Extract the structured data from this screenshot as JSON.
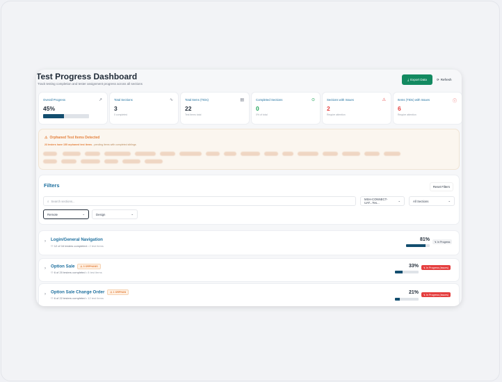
{
  "header": {
    "title": "Test Progress Dashboard",
    "subtitle": "Track testing completion and tester assignment progress across all sections",
    "export_label": "Export Data",
    "refresh_label": "Refresh"
  },
  "cards": [
    {
      "title": "Overall Progress",
      "value": "45%",
      "sub": "",
      "progress": 0.45,
      "icon": "trend-up-icon",
      "color": "#1f2a37"
    },
    {
      "title": "Total Sections",
      "value": "3",
      "sub": "0 completed",
      "icon": "activity-icon",
      "color": "#1f2a37"
    },
    {
      "title": "Total Items (TIDs)",
      "value": "22",
      "sub": "Test items total",
      "icon": "document-icon",
      "color": "#1f2a37"
    },
    {
      "title": "Completed Sections",
      "value": "0",
      "sub": "0% of total",
      "icon": "check-circle-icon",
      "color": "#22a55a"
    },
    {
      "title": "Sections with Issues",
      "value": "2",
      "sub": "Require attention",
      "icon": "warning-icon",
      "color": "#e53e3e"
    },
    {
      "title": "Items (TIDs) with Issues",
      "value": "6",
      "sub": "Require attention",
      "icon": "alert-circle-icon",
      "color": "#e53e3e"
    }
  ],
  "orphaned": {
    "title": "Orphaned Test Items Detected",
    "count_text": "23 testers have 155 orphaned test items",
    "rest_text": " - pending items with completed siblings"
  },
  "filters": {
    "title": "Filters",
    "reset_label": "Reset Filters",
    "search_placeholder": "Search sections...",
    "project_value": "MSH-CONNECT-UAT...Tes...",
    "sections_value": "All Sections",
    "remote_value": "Remote",
    "design_value": "Design"
  },
  "sections": [
    {
      "name": "Login/General Navigation",
      "orphans": "",
      "testers": "12 of 16 testers completed",
      "items": "• 2 test items",
      "percent": "81%",
      "progress": 0.81,
      "status": "In Progress",
      "status_type": "prog"
    },
    {
      "name": "Option Sale",
      "orphans": "3 ORPHANS",
      "testers": "6 of 20 testers completed",
      "items": "• 8 test items",
      "percent": "33%",
      "progress": 0.33,
      "status": "In Progress (Issues)",
      "status_type": "dang"
    },
    {
      "name": "Option Sale Change Order",
      "orphans": "1 ORPHAN",
      "testers": "6 of 22 testers completed",
      "items": "• 12 test items",
      "percent": "21%",
      "progress": 0.21,
      "status": "In Progress (Issues)",
      "status_type": "dang"
    }
  ]
}
